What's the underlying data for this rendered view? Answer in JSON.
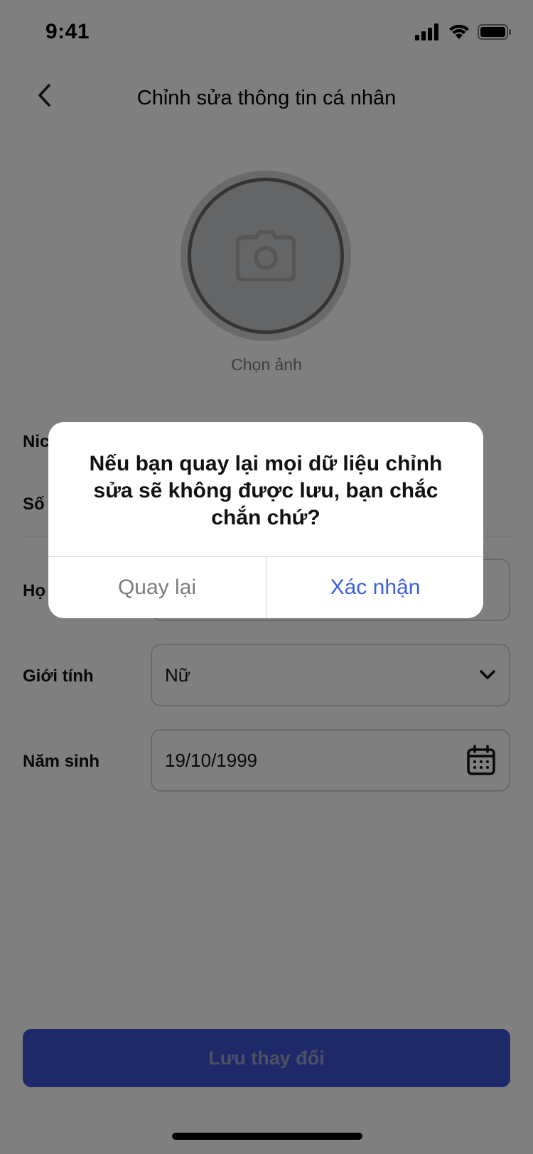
{
  "status_bar": {
    "time": "9:41"
  },
  "header": {
    "title": "Chỉnh sửa thông tin cá nhân"
  },
  "avatar": {
    "label": "Chọn ảnh"
  },
  "form": {
    "nickname_label": "Nic",
    "phone_label": "Số",
    "fullname_label": "Họ",
    "gender_label": "Giới tính",
    "gender_value": "Nữ",
    "birth_label": "Năm sinh",
    "birth_value": "19/10/1999"
  },
  "save_button": {
    "label": "Lưu thay đổi"
  },
  "dialog": {
    "message": "Nếu bạn quay lại mọi dữ liệu chỉnh sửa sẽ không được lưu, bạn chắc chắn chứ?",
    "cancel_label": "Quay lại",
    "confirm_label": "Xác nhận"
  },
  "colors": {
    "primary": "#3d52d4",
    "confirm_text": "#3d5fe0",
    "cancel_text": "#7c7c7c",
    "overlay": "rgba(0,0,0,0.5)"
  }
}
